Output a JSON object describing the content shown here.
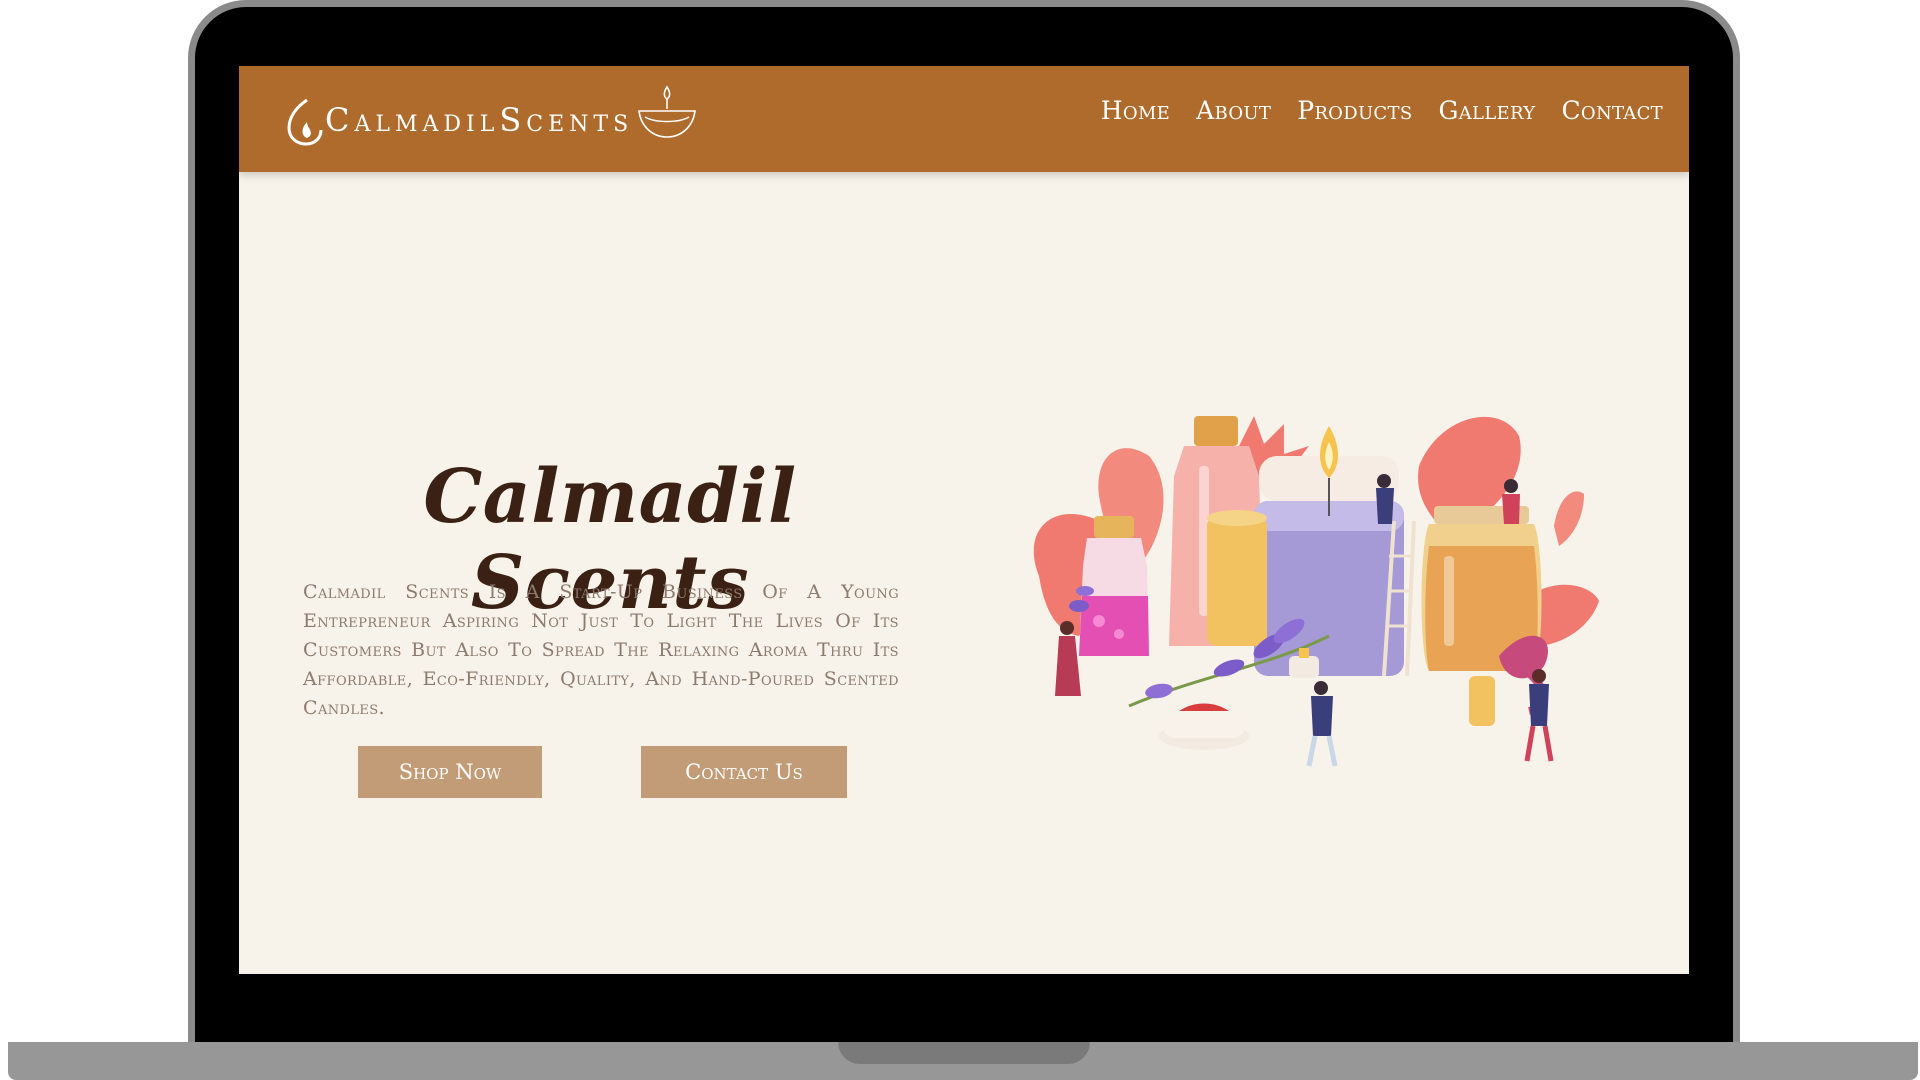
{
  "logo": {
    "text": "CalmadilScents"
  },
  "nav": {
    "items": [
      {
        "label": "Home"
      },
      {
        "label": "About"
      },
      {
        "label": "Products"
      },
      {
        "label": "Gallery"
      },
      {
        "label": "Contact"
      }
    ]
  },
  "hero": {
    "title": "Calmadil Scents",
    "description": "Calmadil Scents Is A Start-Up Business Of A Young Entrepreneur Aspiring Not Just To Light The Lives Of Its Customers But Also To Spread The Relaxing Aroma Thru Its Affordable, Eco-Friendly, Quality, And Hand-Poured Scented Candles.",
    "shop_button": "Shop Now",
    "contact_button": "Contact Us"
  },
  "colors": {
    "header": "#ae6b2c",
    "page_background": "#f7f2ea",
    "button": "#c19c77",
    "title": "#3b2113",
    "body_text": "#8c7b6e"
  },
  "icons": {
    "logo_flame": "flame-icon",
    "logo_bowl": "candle-bowl-icon",
    "illustration": "candle-making-illustration"
  }
}
